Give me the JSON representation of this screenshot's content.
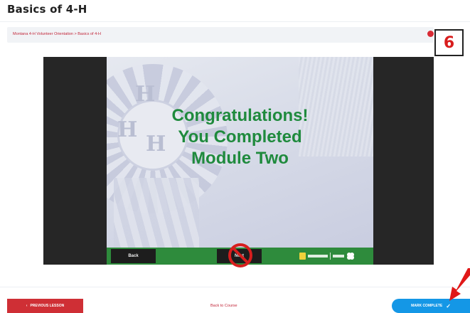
{
  "page": {
    "title": "Basics of 4-H"
  },
  "breadcrumb": {
    "text": "Montana 4-H Volunteer Orientation > Basics of 4-H"
  },
  "step_badge": {
    "number": "6"
  },
  "slide": {
    "line1": "Congratulations!",
    "line2": "You Completed",
    "line3": "Module Two",
    "text_color": "#1f8a3d"
  },
  "player_controls": {
    "back_label": "Back",
    "next_label": "Next",
    "next_state_icon": "prohibited-icon",
    "bar_color": "#2e8b3c"
  },
  "footer": {
    "previous_label": "PREVIOUS LESSON",
    "back_to_course_label": "Back to Course",
    "mark_complete_label": "MARK COMPLETE",
    "previous_color": "#cf2f35",
    "complete_color": "#1497e6"
  },
  "icons": {
    "prev": "chevron-left-icon",
    "complete": "check-icon",
    "pointer": "red-arrow-icon"
  }
}
